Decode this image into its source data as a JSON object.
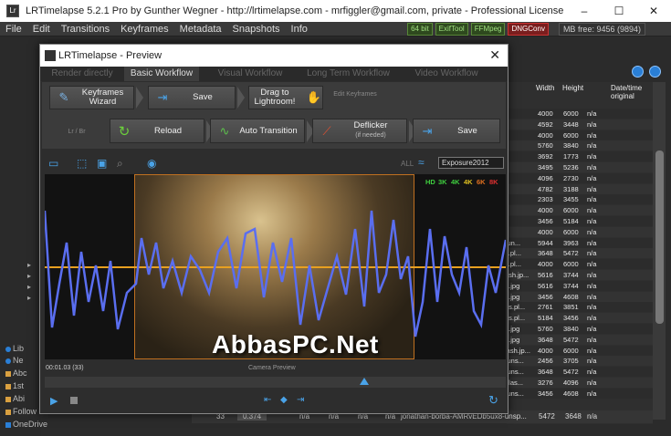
{
  "main": {
    "title": "LRTimelapse 5.2.1 Pro by Gunther Wegner - http://lrtimelapse.com - mrfiggler@gmail.com, private - Professional License",
    "menu": [
      "File",
      "Edit",
      "Transitions",
      "Keyframes",
      "Metadata",
      "Snapshots",
      "Info"
    ],
    "badges": [
      "64 bit",
      "ExifTool",
      "FFMpeg",
      "DNGConv"
    ],
    "mb_free": "MB free: 9456 (9894)",
    "window_controls": {
      "minimize": "–",
      "maximize": "☐",
      "close": "✕"
    }
  },
  "sidebar": {
    "items": [
      "Lib",
      "Ne",
      "Abc",
      "1st",
      "Abi",
      "Follow Us",
      "OneDrive"
    ]
  },
  "table": {
    "headers": [
      "Width",
      "Height",
      "Date/time original"
    ],
    "rows": [
      {
        "name": "",
        "w": "4000",
        "h": "6000",
        "d": "n/a"
      },
      {
        "name": "",
        "w": "4592",
        "h": "3448",
        "d": "n/a"
      },
      {
        "name": "",
        "w": "4000",
        "h": "6000",
        "d": "n/a"
      },
      {
        "name": "",
        "w": "5760",
        "h": "3840",
        "d": "n/a"
      },
      {
        "name": "",
        "w": "3692",
        "h": "1773",
        "d": "n/a"
      },
      {
        "name": "",
        "w": "3495",
        "h": "5236",
        "d": "n/a"
      },
      {
        "name": "",
        "w": "4096",
        "h": "2730",
        "d": "n/a"
      },
      {
        "name": "",
        "w": "4782",
        "h": "3188",
        "d": "n/a"
      },
      {
        "name": "",
        "w": "2303",
        "h": "3455",
        "d": "n/a"
      },
      {
        "name": "",
        "w": "4000",
        "h": "6000",
        "d": "n/a"
      },
      {
        "name": "",
        "w": "3456",
        "h": "5184",
        "d": "n/a"
      },
      {
        "name": "",
        "w": "4000",
        "h": "6000",
        "d": "n/a"
      },
      {
        "name": "-un...",
        "w": "5944",
        "h": "3963",
        "d": "n/a"
      },
      {
        "name": "s.pl...",
        "w": "3648",
        "h": "5472",
        "d": "n/a"
      },
      {
        "name": "s.pl...",
        "w": "4000",
        "h": "6000",
        "d": "n/a"
      },
      {
        "name": "ash.jp...",
        "w": "5616",
        "h": "3744",
        "d": "n/a"
      },
      {
        "name": "a.jpg",
        "w": "5616",
        "h": "3744",
        "d": "n/a"
      },
      {
        "name": "h.jpg",
        "w": "3456",
        "h": "4608",
        "d": "n/a"
      },
      {
        "name": "ns.pl...",
        "w": "2761",
        "h": "3851",
        "d": "n/a"
      },
      {
        "name": "ns.pl...",
        "w": "5184",
        "h": "3456",
        "d": "n/a"
      },
      {
        "name": "a.jpg",
        "w": "5760",
        "h": "3840",
        "d": "n/a"
      },
      {
        "name": "h.jpg",
        "w": "3648",
        "h": "5472",
        "d": "n/a"
      },
      {
        "name": "lash.jp...",
        "w": "4000",
        "h": "6000",
        "d": "n/a"
      },
      {
        "name": "-uns...",
        "w": "2456",
        "h": "3705",
        "d": "n/a"
      },
      {
        "name": "-uns...",
        "w": "3648",
        "h": "5472",
        "d": "n/a"
      },
      {
        "name": "olas...",
        "w": "3276",
        "h": "4096",
        "d": "n/a"
      },
      {
        "name": "-uns...",
        "w": "3456",
        "h": "4608",
        "d": "n/a"
      }
    ],
    "bottom_row": {
      "idx": "33",
      "val": "0.374",
      "na1": "n/a",
      "na2": "n/a",
      "na3": "n/a",
      "na4": "n/a",
      "file": "jonathan-borba-AMRvEDb5ux8-unsp...",
      "w": "5472",
      "h": "3648",
      "d": "n/a"
    }
  },
  "preview": {
    "title": "LRTimelapse - Preview",
    "close": "✕",
    "tabs": [
      "Render directly",
      "Basic Workflow",
      "Visual Workflow",
      "Long Term Workflow",
      "Video Workflow"
    ],
    "row1": {
      "keyframes_wizard": "Keyframes Wizard",
      "save": "Save",
      "drag": "Drag to Lightroom!",
      "edit_kf": "Edit Keyframes"
    },
    "row2": {
      "lr_br": "Lr / Br",
      "reload": "Reload",
      "auto_transition": "Auto Transition",
      "deflicker": "Deflicker",
      "deflicker_sub": "(if needed)",
      "save": "Save"
    },
    "all_label": "ALL",
    "exposure_value": "Exposure2012",
    "quality": [
      "HD",
      "3K",
      "4K",
      "4K",
      "6K",
      "8K"
    ],
    "quality_colors": [
      "#3fcf3f",
      "#3fcf3f",
      "#3fcf3f",
      "#e0c020",
      "#e07020",
      "#e03030"
    ],
    "timecode": "00:01.03 (33)",
    "camera_preview": "Camera Preview",
    "watermark": "AbbasPC.Net"
  }
}
